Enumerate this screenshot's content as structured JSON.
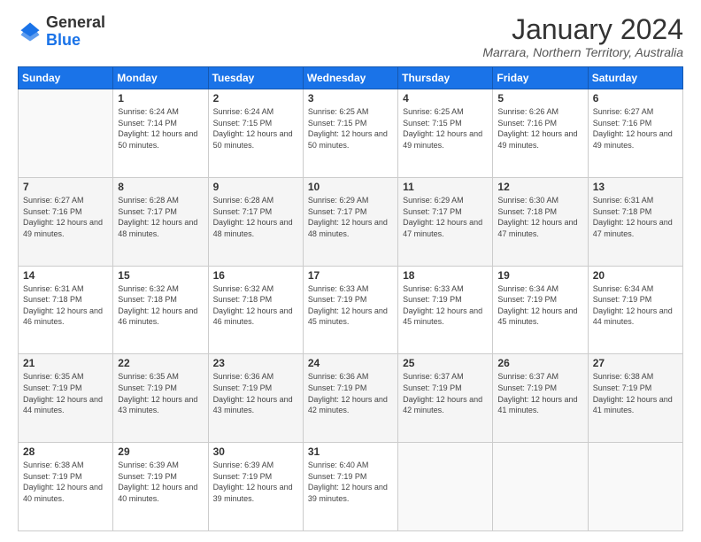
{
  "header": {
    "logo_general": "General",
    "logo_blue": "Blue",
    "month_title": "January 2024",
    "location": "Marrara, Northern Territory, Australia"
  },
  "days_of_week": [
    "Sunday",
    "Monday",
    "Tuesday",
    "Wednesday",
    "Thursday",
    "Friday",
    "Saturday"
  ],
  "weeks": [
    [
      {
        "day": "",
        "sunrise": "",
        "sunset": "",
        "daylight": ""
      },
      {
        "day": "1",
        "sunrise": "Sunrise: 6:24 AM",
        "sunset": "Sunset: 7:14 PM",
        "daylight": "Daylight: 12 hours and 50 minutes."
      },
      {
        "day": "2",
        "sunrise": "Sunrise: 6:24 AM",
        "sunset": "Sunset: 7:15 PM",
        "daylight": "Daylight: 12 hours and 50 minutes."
      },
      {
        "day": "3",
        "sunrise": "Sunrise: 6:25 AM",
        "sunset": "Sunset: 7:15 PM",
        "daylight": "Daylight: 12 hours and 50 minutes."
      },
      {
        "day": "4",
        "sunrise": "Sunrise: 6:25 AM",
        "sunset": "Sunset: 7:15 PM",
        "daylight": "Daylight: 12 hours and 49 minutes."
      },
      {
        "day": "5",
        "sunrise": "Sunrise: 6:26 AM",
        "sunset": "Sunset: 7:16 PM",
        "daylight": "Daylight: 12 hours and 49 minutes."
      },
      {
        "day": "6",
        "sunrise": "Sunrise: 6:27 AM",
        "sunset": "Sunset: 7:16 PM",
        "daylight": "Daylight: 12 hours and 49 minutes."
      }
    ],
    [
      {
        "day": "7",
        "sunrise": "Sunrise: 6:27 AM",
        "sunset": "Sunset: 7:16 PM",
        "daylight": "Daylight: 12 hours and 49 minutes."
      },
      {
        "day": "8",
        "sunrise": "Sunrise: 6:28 AM",
        "sunset": "Sunset: 7:17 PM",
        "daylight": "Daylight: 12 hours and 48 minutes."
      },
      {
        "day": "9",
        "sunrise": "Sunrise: 6:28 AM",
        "sunset": "Sunset: 7:17 PM",
        "daylight": "Daylight: 12 hours and 48 minutes."
      },
      {
        "day": "10",
        "sunrise": "Sunrise: 6:29 AM",
        "sunset": "Sunset: 7:17 PM",
        "daylight": "Daylight: 12 hours and 48 minutes."
      },
      {
        "day": "11",
        "sunrise": "Sunrise: 6:29 AM",
        "sunset": "Sunset: 7:17 PM",
        "daylight": "Daylight: 12 hours and 47 minutes."
      },
      {
        "day": "12",
        "sunrise": "Sunrise: 6:30 AM",
        "sunset": "Sunset: 7:18 PM",
        "daylight": "Daylight: 12 hours and 47 minutes."
      },
      {
        "day": "13",
        "sunrise": "Sunrise: 6:31 AM",
        "sunset": "Sunset: 7:18 PM",
        "daylight": "Daylight: 12 hours and 47 minutes."
      }
    ],
    [
      {
        "day": "14",
        "sunrise": "Sunrise: 6:31 AM",
        "sunset": "Sunset: 7:18 PM",
        "daylight": "Daylight: 12 hours and 46 minutes."
      },
      {
        "day": "15",
        "sunrise": "Sunrise: 6:32 AM",
        "sunset": "Sunset: 7:18 PM",
        "daylight": "Daylight: 12 hours and 46 minutes."
      },
      {
        "day": "16",
        "sunrise": "Sunrise: 6:32 AM",
        "sunset": "Sunset: 7:18 PM",
        "daylight": "Daylight: 12 hours and 46 minutes."
      },
      {
        "day": "17",
        "sunrise": "Sunrise: 6:33 AM",
        "sunset": "Sunset: 7:19 PM",
        "daylight": "Daylight: 12 hours and 45 minutes."
      },
      {
        "day": "18",
        "sunrise": "Sunrise: 6:33 AM",
        "sunset": "Sunset: 7:19 PM",
        "daylight": "Daylight: 12 hours and 45 minutes."
      },
      {
        "day": "19",
        "sunrise": "Sunrise: 6:34 AM",
        "sunset": "Sunset: 7:19 PM",
        "daylight": "Daylight: 12 hours and 45 minutes."
      },
      {
        "day": "20",
        "sunrise": "Sunrise: 6:34 AM",
        "sunset": "Sunset: 7:19 PM",
        "daylight": "Daylight: 12 hours and 44 minutes."
      }
    ],
    [
      {
        "day": "21",
        "sunrise": "Sunrise: 6:35 AM",
        "sunset": "Sunset: 7:19 PM",
        "daylight": "Daylight: 12 hours and 44 minutes."
      },
      {
        "day": "22",
        "sunrise": "Sunrise: 6:35 AM",
        "sunset": "Sunset: 7:19 PM",
        "daylight": "Daylight: 12 hours and 43 minutes."
      },
      {
        "day": "23",
        "sunrise": "Sunrise: 6:36 AM",
        "sunset": "Sunset: 7:19 PM",
        "daylight": "Daylight: 12 hours and 43 minutes."
      },
      {
        "day": "24",
        "sunrise": "Sunrise: 6:36 AM",
        "sunset": "Sunset: 7:19 PM",
        "daylight": "Daylight: 12 hours and 42 minutes."
      },
      {
        "day": "25",
        "sunrise": "Sunrise: 6:37 AM",
        "sunset": "Sunset: 7:19 PM",
        "daylight": "Daylight: 12 hours and 42 minutes."
      },
      {
        "day": "26",
        "sunrise": "Sunrise: 6:37 AM",
        "sunset": "Sunset: 7:19 PM",
        "daylight": "Daylight: 12 hours and 41 minutes."
      },
      {
        "day": "27",
        "sunrise": "Sunrise: 6:38 AM",
        "sunset": "Sunset: 7:19 PM",
        "daylight": "Daylight: 12 hours and 41 minutes."
      }
    ],
    [
      {
        "day": "28",
        "sunrise": "Sunrise: 6:38 AM",
        "sunset": "Sunset: 7:19 PM",
        "daylight": "Daylight: 12 hours and 40 minutes."
      },
      {
        "day": "29",
        "sunrise": "Sunrise: 6:39 AM",
        "sunset": "Sunset: 7:19 PM",
        "daylight": "Daylight: 12 hours and 40 minutes."
      },
      {
        "day": "30",
        "sunrise": "Sunrise: 6:39 AM",
        "sunset": "Sunset: 7:19 PM",
        "daylight": "Daylight: 12 hours and 39 minutes."
      },
      {
        "day": "31",
        "sunrise": "Sunrise: 6:40 AM",
        "sunset": "Sunset: 7:19 PM",
        "daylight": "Daylight: 12 hours and 39 minutes."
      },
      {
        "day": "",
        "sunrise": "",
        "sunset": "",
        "daylight": ""
      },
      {
        "day": "",
        "sunrise": "",
        "sunset": "",
        "daylight": ""
      },
      {
        "day": "",
        "sunrise": "",
        "sunset": "",
        "daylight": ""
      }
    ]
  ]
}
